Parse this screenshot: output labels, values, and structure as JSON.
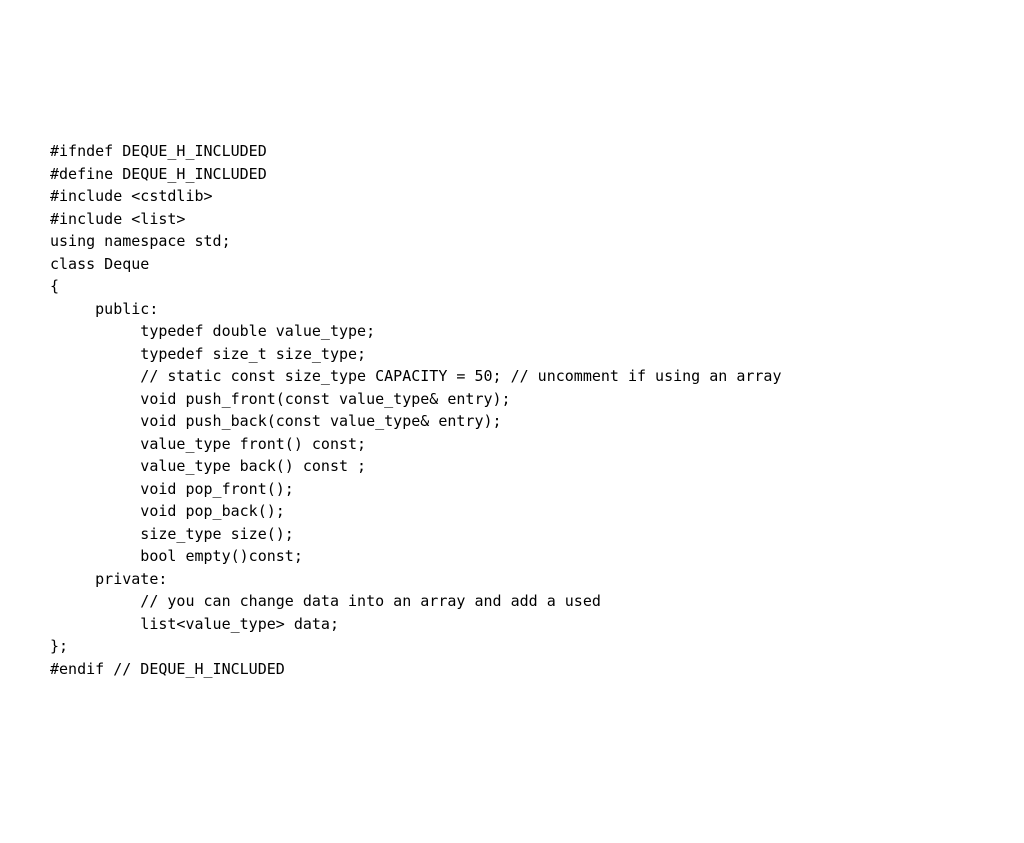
{
  "code": {
    "lines": [
      "#ifndef DEQUE_H_INCLUDED",
      "#define DEQUE_H_INCLUDED",
      "#include <cstdlib>",
      "#include <list>",
      "using namespace std;",
      "",
      "class Deque",
      "{",
      "     public:",
      "          typedef double value_type;",
      "          typedef size_t size_type;",
      "          // static const size_type CAPACITY = 50; // uncomment if using an array",
      "          void push_front(const value_type& entry);",
      "          void push_back(const value_type& entry);",
      "          value_type front() const;",
      "          value_type back() const ;",
      "          void pop_front();",
      "          void pop_back();",
      "          size_type size();",
      "          bool empty()const;",
      "     private:",
      "          // you can change data into an array and add a used",
      "          list<value_type> data;",
      "};",
      "",
      "#endif // DEQUE_H_INCLUDED"
    ]
  }
}
